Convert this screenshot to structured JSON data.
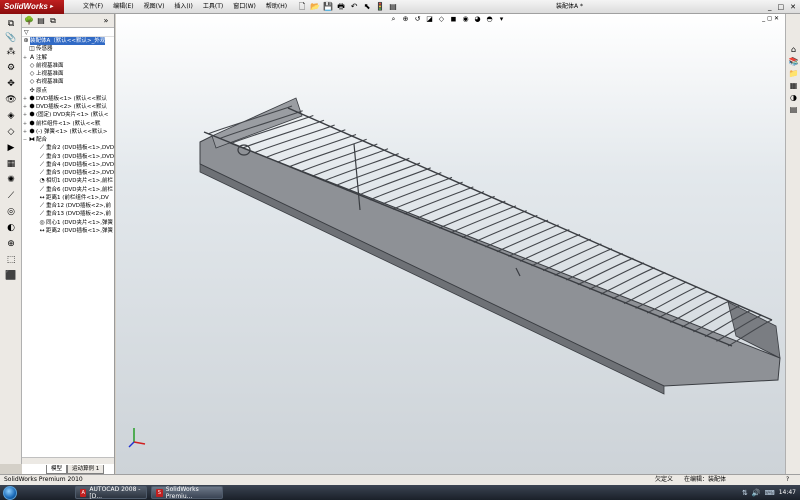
{
  "app": {
    "logo_text": "SolidWorks",
    "doc_title": "装配体A *"
  },
  "menu": [
    {
      "name": "file",
      "label": "文件(F)"
    },
    {
      "name": "edit",
      "label": "编辑(E)"
    },
    {
      "name": "view",
      "label": "视图(V)"
    },
    {
      "name": "insert",
      "label": "插入(I)"
    },
    {
      "name": "tools",
      "label": "工具(T)"
    },
    {
      "name": "window",
      "label": "窗口(W)"
    },
    {
      "name": "help",
      "label": "帮助(H)"
    }
  ],
  "top_toolbar_icons": [
    "new-icon",
    "open-icon",
    "save-icon",
    "print-icon",
    "undo-icon",
    "select-icon",
    "rebuild-icon",
    "options-icon"
  ],
  "window_controls": {
    "minimize": "_",
    "restore": "□",
    "close": "✕"
  },
  "feature_tree": {
    "filter_symbol": "▽",
    "root": "装配体A（默认<<默认>_外观",
    "nodes": [
      {
        "name": "sensors",
        "label": "传感器",
        "icon": "sensor-icon",
        "expander": "",
        "level": 1
      },
      {
        "name": "annotations",
        "label": "注解",
        "icon": "annotation-icon",
        "expander": "+",
        "level": 1
      },
      {
        "name": "front-plane",
        "label": "前视基准面",
        "icon": "plane-icon",
        "expander": "",
        "level": 1
      },
      {
        "name": "top-plane",
        "label": "上视基准面",
        "icon": "plane-icon",
        "expander": "",
        "level": 1
      },
      {
        "name": "right-plane",
        "label": "右视基准面",
        "icon": "plane-icon",
        "expander": "",
        "level": 1
      },
      {
        "name": "origin",
        "label": "原点",
        "icon": "origin-icon",
        "expander": "",
        "level": 1
      },
      {
        "name": "dvd-board-1",
        "label": "DVD插板<1> (默认<<默认",
        "icon": "part-icon",
        "expander": "+",
        "level": 1
      },
      {
        "name": "dvd-board-2",
        "label": "DVD插板<2> (默认<<默认",
        "icon": "part-icon",
        "expander": "+",
        "level": 1
      },
      {
        "name": "dvd-clip-1",
        "label": "(固定) DVD夹片<1> (默认<",
        "icon": "part-icon",
        "expander": "+",
        "level": 1
      },
      {
        "name": "front-rail-1",
        "label": "前栏组件<1> (默认<<默",
        "icon": "part-icon",
        "expander": "+",
        "level": 1
      },
      {
        "name": "spring-1",
        "label": "(-) 弹簧<1> (默认<<默认>",
        "icon": "part-icon",
        "expander": "+",
        "level": 1
      },
      {
        "name": "mates",
        "label": "配合",
        "icon": "mate-icon",
        "expander": "−",
        "level": 1
      },
      {
        "name": "mate-coincident-2",
        "label": "重合2 (DVD插板<1>,DVD",
        "icon": "coincident-icon",
        "expander": "",
        "level": 2
      },
      {
        "name": "mate-coincident-3",
        "label": "重合3 (DVD插板<1>,DVD",
        "icon": "coincident-icon",
        "expander": "",
        "level": 2
      },
      {
        "name": "mate-coincident-4",
        "label": "重合4 (DVD插板<1>,DVD",
        "icon": "coincident-icon",
        "expander": "",
        "level": 2
      },
      {
        "name": "mate-coincident-5",
        "label": "重合5 (DVD插板<2>,DVD",
        "icon": "coincident-icon",
        "expander": "",
        "level": 2
      },
      {
        "name": "mate-tangent-1",
        "label": "相切1 (DVD夹片<1>,前栏",
        "icon": "tangent-icon",
        "expander": "",
        "level": 2
      },
      {
        "name": "mate-coincident-6",
        "label": "重合6 (DVD夹片<1>,前栏",
        "icon": "coincident-icon",
        "expander": "",
        "level": 2
      },
      {
        "name": "mate-distance-1",
        "label": "距离1 (前栏组件<1>,DV",
        "icon": "distance-icon",
        "expander": "",
        "level": 2
      },
      {
        "name": "mate-coincident-12",
        "label": "重合12 (DVD插板<2>,前",
        "icon": "coincident-icon",
        "expander": "",
        "level": 2
      },
      {
        "name": "mate-coincident-13",
        "label": "重合13 (DVD插板<2>,前",
        "icon": "coincident-icon",
        "expander": "",
        "level": 2
      },
      {
        "name": "mate-concentric-1",
        "label": "同心1 (DVD夹片<1>,弹簧",
        "icon": "concentric-icon",
        "expander": "",
        "level": 2
      },
      {
        "name": "mate-distance-2",
        "label": "距离2 (DVD插板<1>,弹簧",
        "icon": "distance-icon",
        "expander": "",
        "level": 2
      }
    ]
  },
  "fm_tabs": [
    {
      "name": "model",
      "label": "模型"
    },
    {
      "name": "motion-study-1",
      "label": "运动算例 1"
    }
  ],
  "status": {
    "product": "SolidWorks Premium 2010",
    "constraint": "欠定义",
    "editing": "在编辑：装配体",
    "help_symbol": "?"
  },
  "taskbar": {
    "items": [
      {
        "name": "autocad",
        "label": "AUTOCAD 2008 - [D..."
      },
      {
        "name": "solidworks",
        "label": "SolidWorks Premiu..."
      }
    ],
    "clock": "14:47"
  },
  "colors": {
    "accent": "#316ac5",
    "logo_red": "#c02020",
    "model_fill": "#8e9196",
    "model_edge": "#3a3d42"
  }
}
